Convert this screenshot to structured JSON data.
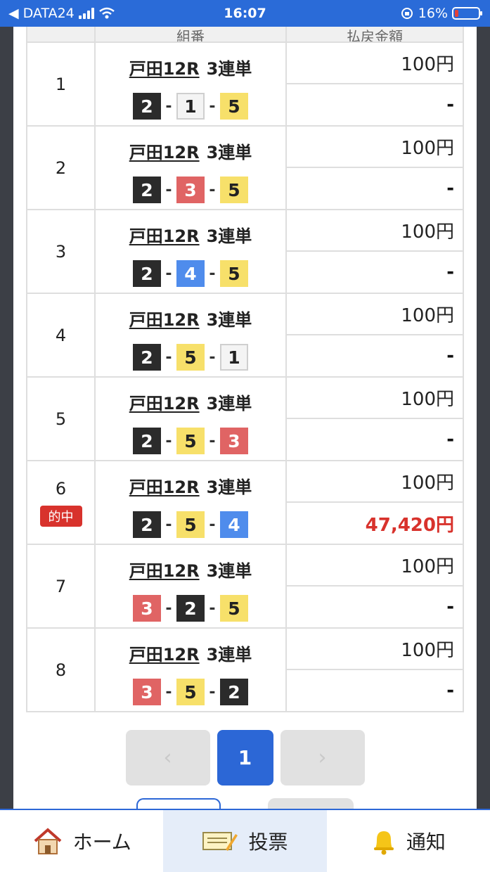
{
  "status_bar": {
    "carrier": "DATA24",
    "time": "16:07",
    "battery_percent": "16%",
    "battery_level": 0.16,
    "colors": {
      "bar": "#2a6bd8",
      "battery_low": "#e2423a"
    }
  },
  "table": {
    "headers": {
      "number": "",
      "combination": "組番",
      "amount": "払戻金額"
    },
    "rows": [
      {
        "no": "1",
        "race": "戸田12R",
        "bet_type": "3連単",
        "boats": [
          "2",
          "1",
          "5"
        ],
        "stake": "100円",
        "payout": "-",
        "hit": false
      },
      {
        "no": "2",
        "race": "戸田12R",
        "bet_type": "3連単",
        "boats": [
          "2",
          "3",
          "5"
        ],
        "stake": "100円",
        "payout": "-",
        "hit": false
      },
      {
        "no": "3",
        "race": "戸田12R",
        "bet_type": "3連単",
        "boats": [
          "2",
          "4",
          "5"
        ],
        "stake": "100円",
        "payout": "-",
        "hit": false
      },
      {
        "no": "4",
        "race": "戸田12R",
        "bet_type": "3連単",
        "boats": [
          "2",
          "5",
          "1"
        ],
        "stake": "100円",
        "payout": "-",
        "hit": false
      },
      {
        "no": "5",
        "race": "戸田12R",
        "bet_type": "3連単",
        "boats": [
          "2",
          "5",
          "3"
        ],
        "stake": "100円",
        "payout": "-",
        "hit": false
      },
      {
        "no": "6",
        "race": "戸田12R",
        "bet_type": "3連単",
        "boats": [
          "2",
          "5",
          "4"
        ],
        "stake": "100円",
        "payout": "47,420円",
        "hit": true,
        "hit_label": "的中"
      },
      {
        "no": "7",
        "race": "戸田12R",
        "bet_type": "3連単",
        "boats": [
          "3",
          "2",
          "5"
        ],
        "stake": "100円",
        "payout": "-",
        "hit": false
      },
      {
        "no": "8",
        "race": "戸田12R",
        "bet_type": "3連単",
        "boats": [
          "3",
          "5",
          "2"
        ],
        "stake": "100円",
        "payout": "-",
        "hit": false
      }
    ],
    "boat_separator": "-",
    "boat_colors": {
      "1": "#f4f4f4",
      "2": "#2b2b2b",
      "3": "#e06464",
      "4": "#4f8cec",
      "5": "#f7e06a"
    },
    "hit_color": "#d8322c"
  },
  "pagination": {
    "prev": "‹",
    "current": "1",
    "next": "›",
    "accent": "#2c67d6"
  },
  "bottom_nav": {
    "items": [
      {
        "label": "ホーム",
        "icon": "home-icon",
        "active": false
      },
      {
        "label": "投票",
        "icon": "ticket-icon",
        "active": true
      },
      {
        "label": "通知",
        "icon": "bell-icon",
        "active": false
      }
    ]
  }
}
